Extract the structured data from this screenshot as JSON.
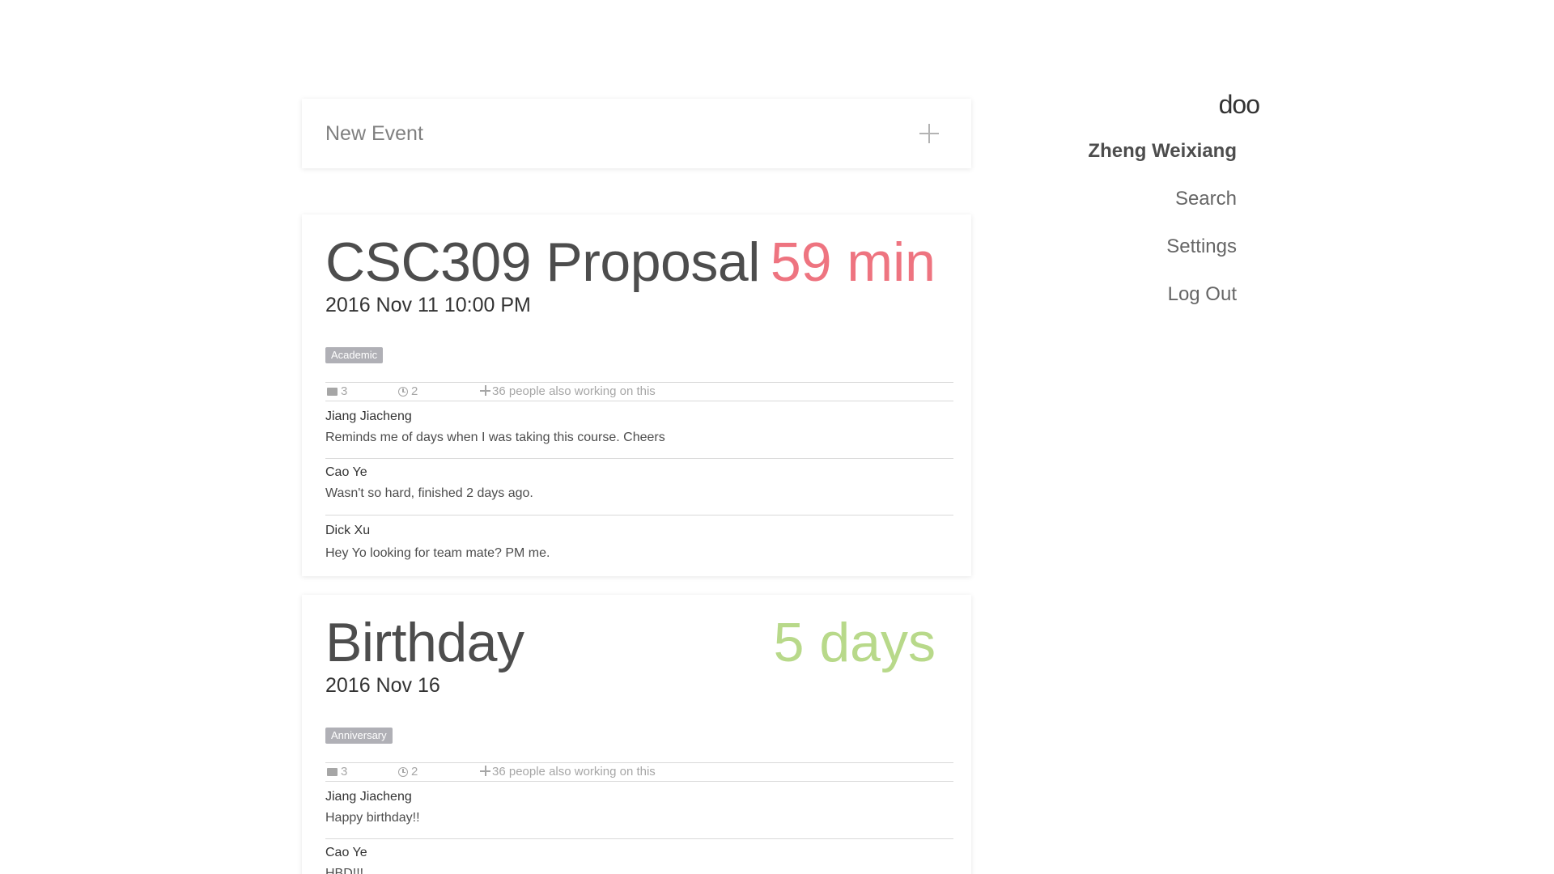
{
  "new_event": {
    "label": "New Event",
    "add_icon": "plus-icon"
  },
  "nav": {
    "brand": "doo",
    "user": "Zheng Weixiang",
    "items": [
      {
        "label": "Search"
      },
      {
        "label": "Settings"
      },
      {
        "label": "Log Out"
      }
    ]
  },
  "colors": {
    "countdown_urgent": "#ee7480",
    "countdown_later": "#b8d98a",
    "tag_background": "#b0b0b6"
  },
  "events": [
    {
      "title": "CSC309 Proposal",
      "countdown": "59 min",
      "date": "2016 Nov 11 10:00 PM",
      "tag": "Academic",
      "stats": {
        "comments": "3",
        "reminders": "2",
        "people": "36 people also working on this"
      },
      "comments": [
        {
          "author": "Jiang Jiacheng",
          "text": "Reminds me of days when I was taking this course. Cheers"
        },
        {
          "author": "Cao Ye",
          "text": "Wasn't so hard, finished 2 days ago."
        },
        {
          "author": "Dick Xu",
          "text": "Hey Yo looking for team mate? PM me."
        }
      ]
    },
    {
      "title": "Birthday",
      "countdown": "5 days",
      "date": "2016 Nov 16",
      "tag": "Anniversary",
      "stats": {
        "comments": "3",
        "reminders": "2",
        "people": "36 people also working on this"
      },
      "comments": [
        {
          "author": "Jiang Jiacheng",
          "text": "Happy birthday!!"
        },
        {
          "author": "Cao Ye",
          "text": "HBD!!!"
        }
      ]
    }
  ]
}
